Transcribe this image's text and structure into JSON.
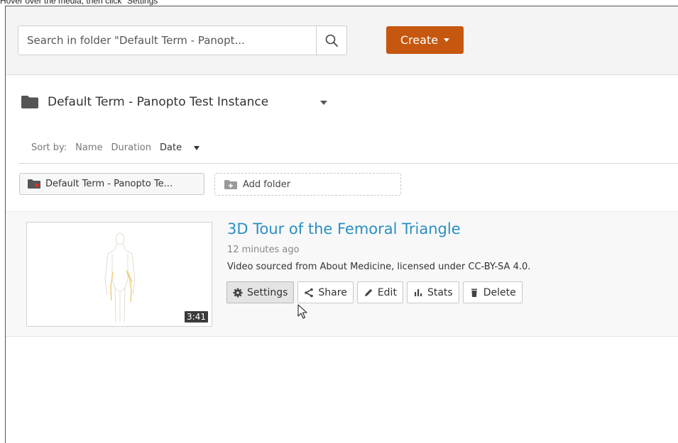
{
  "instruction": "Hover over the media, then click \"Settings\"",
  "header": {
    "search_placeholder": "Search in folder \"Default Term - Panopt...",
    "create_label": "Create"
  },
  "folder": {
    "title": "Default Term - Panopto Test Instance"
  },
  "sort": {
    "label": "Sort by:",
    "options": [
      "Name",
      "Duration",
      "Date"
    ],
    "active": "Date"
  },
  "breadcrumb": {
    "folder_chip": "Default Term - Panopto Te...",
    "add_folder": "Add folder"
  },
  "session": {
    "title": "3D Tour of the Femoral Triangle",
    "time": "12 minutes ago",
    "description": "Video sourced from About Medicine, licensed under CC-BY-SA 4.0.",
    "duration": "3:41",
    "actions": [
      "Settings",
      "Share",
      "Edit",
      "Stats",
      "Delete"
    ]
  },
  "colors": {
    "create_button": "#c6570e",
    "title_link": "#2a8fc4",
    "header_bg": "#f4f4f4"
  }
}
